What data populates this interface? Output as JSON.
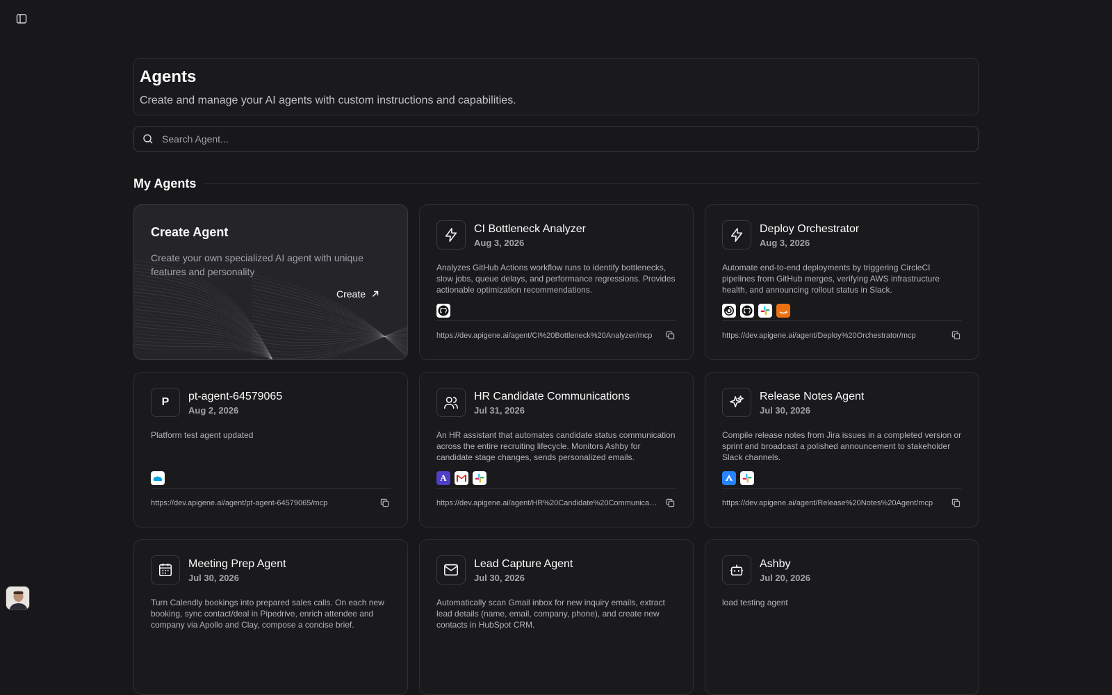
{
  "header": {
    "title": "Agents",
    "subtitle": "Create and manage your AI agents with custom instructions and capabilities."
  },
  "search": {
    "placeholder": "Search Agent..."
  },
  "section": {
    "title": "My Agents"
  },
  "create_card": {
    "title": "Create Agent",
    "description": "Create your own specialized AI agent with unique features and personality",
    "button_label": "Create"
  },
  "agents": [
    {
      "name": "CI Bottleneck Analyzer",
      "date": "Aug 3, 2026",
      "icon": "lightning-icon",
      "description": "Analyzes GitHub Actions workflow runs to identify bottlenecks, slow jobs, queue delays, and performance regressions. Provides actionable optimization recommendations.",
      "tools": [
        "github"
      ],
      "url": "https://dev.apigene.ai/agent/CI%20Bottleneck%20Analyzer/mcp"
    },
    {
      "name": "Deploy Orchestrator",
      "date": "Aug 3, 2026",
      "icon": "lightning-icon",
      "description": "Automate end-to-end deployments by triggering CircleCI pipelines from GitHub merges, verifying AWS infrastructure health, and announcing rollout status in Slack.",
      "tools": [
        "circleci",
        "github",
        "slack",
        "aws"
      ],
      "url": "https://dev.apigene.ai/agent/Deploy%20Orchestrator/mcp"
    },
    {
      "name": "pt-agent-64579065",
      "date": "Aug 2, 2026",
      "icon": "letter-p-icon",
      "icon_letter": "P",
      "description": "Platform test agent updated",
      "tools": [
        "salesforce"
      ],
      "url": "https://dev.apigene.ai/agent/pt-agent-64579065/mcp"
    },
    {
      "name": "HR Candidate Communications",
      "date": "Jul 31, 2026",
      "icon": "users-icon",
      "description": "An HR assistant that automates candidate status communication across the entire recruiting lifecycle. Monitors Ashby for candidate stage changes, sends personalized emails.",
      "tools": [
        "ashby",
        "gmail",
        "slack"
      ],
      "url": "https://dev.apigene.ai/agent/HR%20Candidate%20Communications/mcp"
    },
    {
      "name": "Release Notes Agent",
      "date": "Jul 30, 2026",
      "icon": "sparkles-icon",
      "description": "Compile release notes from Jira issues in a completed version or sprint and broadcast a polished announcement to stakeholder Slack channels.",
      "tools": [
        "jira",
        "slack"
      ],
      "url": "https://dev.apigene.ai/agent/Release%20Notes%20Agent/mcp"
    },
    {
      "name": "Meeting Prep Agent",
      "date": "Jul 30, 2026",
      "icon": "calendar-icon",
      "description": "Turn Calendly bookings into prepared sales calls. On each new booking, sync contact/deal in Pipedrive, enrich attendee and company via Apollo and Clay, compose a concise brief.",
      "tools": [],
      "url": ""
    },
    {
      "name": "Lead Capture Agent",
      "date": "Jul 30, 2026",
      "icon": "mail-icon",
      "description": "Automatically scan Gmail inbox for new inquiry emails, extract lead details (name, email, company, phone), and create new contacts in HubSpot CRM.",
      "tools": [],
      "url": ""
    },
    {
      "name": "Ashby",
      "date": "Jul 20, 2026",
      "icon": "bot-icon",
      "description": "load testing agent",
      "tools": [],
      "url": ""
    }
  ]
}
